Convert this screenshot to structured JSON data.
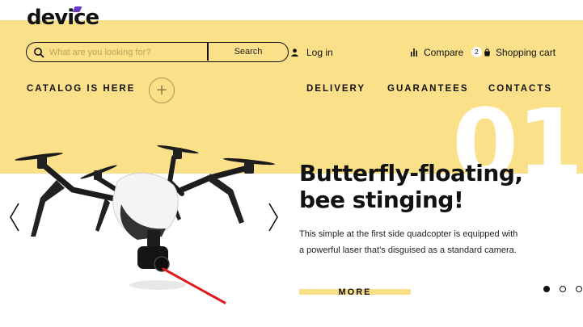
{
  "header": {
    "logo_text": "device",
    "search": {
      "placeholder": "What are you looking for?",
      "button_label": "Search"
    },
    "login_label": "Log in",
    "compare_label": "Compare",
    "cart": {
      "count": "2",
      "label": "Shopping cart"
    }
  },
  "nav": {
    "catalog_label": "CATALOG IS HERE",
    "plus_symbol": "+",
    "links": [
      "DELIVERY",
      "GUARANTEES",
      "CONTACTS"
    ]
  },
  "slide": {
    "number": "01",
    "title_line1": "Butterfly-floating,",
    "title_line2": "bee stinging!",
    "desc_line1": "This simple at the first side quadcopter is equipped with",
    "desc_line2": "a powerful laser that’s disguised as a standard camera.",
    "more_label": "MORE",
    "dots_count": 3,
    "active_dot": 1
  },
  "colors": {
    "accent_yellow": "#fbe08a",
    "logo_accent": "#6a38c7",
    "laser_red": "#e01b1b"
  },
  "icons": {
    "search": "search-icon",
    "user": "user-icon",
    "compare": "bar-chart-icon",
    "cart": "shopping-bag-icon",
    "left": "chevron-left-icon",
    "right": "chevron-right-icon"
  }
}
